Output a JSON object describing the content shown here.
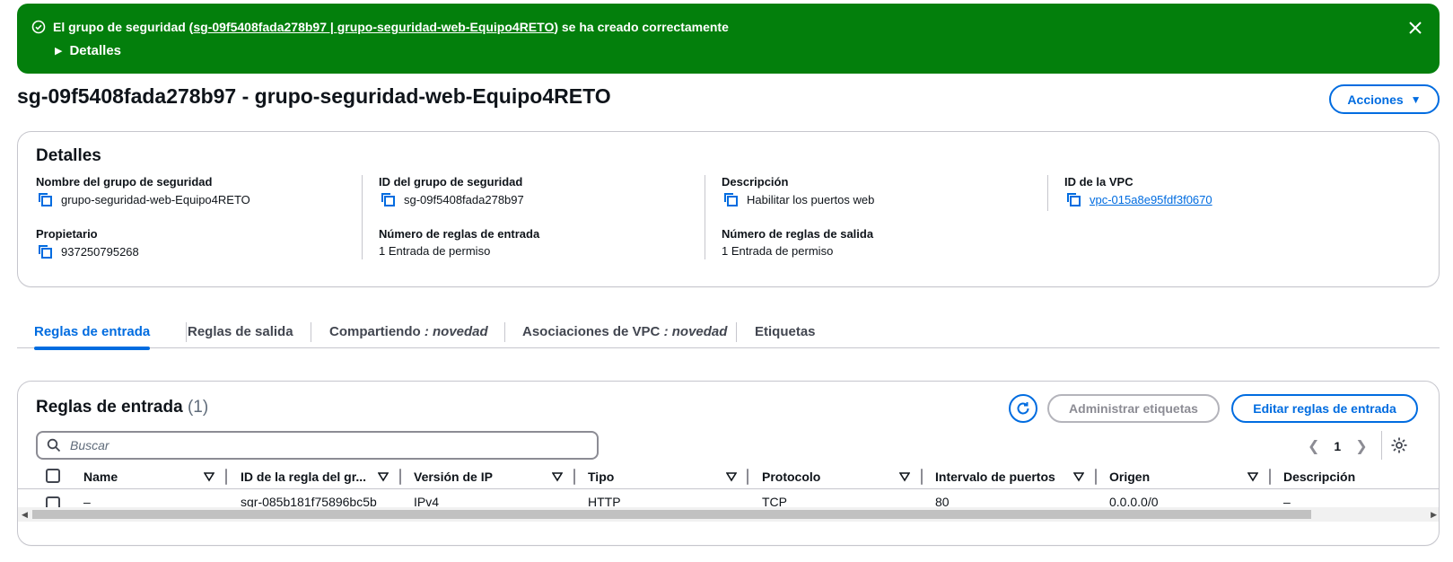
{
  "flash": {
    "text_prefix": "El grupo de seguridad (",
    "link_text": "sg-09f5408fada278b97 | grupo-seguridad-web-Equipo4RETO",
    "text_suffix": ") se ha creado correctamente",
    "details_label": "Detalles",
    "color": "#037f0c"
  },
  "page": {
    "title": "sg-09f5408fada278b97 - grupo-seguridad-web-Equipo4RETO",
    "actions_label": "Acciones"
  },
  "details": {
    "heading": "Detalles",
    "fields": [
      {
        "label": "Nombre del grupo de seguridad",
        "value": "grupo-seguridad-web-Equipo4RETO"
      },
      {
        "label": "ID del grupo de seguridad",
        "value": "sg-09f5408fada278b97"
      },
      {
        "label": "Descripción",
        "value": "Habilitar los puertos web"
      },
      {
        "label": "ID de la VPC",
        "value": "vpc-015a8e95fdf3f0670"
      },
      {
        "label": "Propietario",
        "value": "937250795268"
      },
      {
        "label": "Número de reglas de entrada",
        "value": "1 Entrada de permiso"
      },
      {
        "label": "Número de reglas de salida",
        "value": "1 Entrada de permiso"
      }
    ]
  },
  "tabs": [
    {
      "label": "Reglas de entrada",
      "suffix": ""
    },
    {
      "label": "Reglas de salida",
      "suffix": ""
    },
    {
      "label": "Compartiendo",
      "suffix": ": novedad"
    },
    {
      "label": "Asociaciones de VPC",
      "suffix": ": novedad"
    },
    {
      "label": "Etiquetas",
      "suffix": ""
    }
  ],
  "rules": {
    "heading": "Reglas de entrada",
    "count": "(1)",
    "manage_tags_label": "Administrar etiquetas",
    "edit_label": "Editar reglas de entrada",
    "search_placeholder": "Buscar",
    "page_number": "1",
    "columns": [
      "Name",
      "ID de la regla del gr...",
      "Versión de IP",
      "Tipo",
      "Protocolo",
      "Intervalo de puertos",
      "Origen",
      "Descripción"
    ],
    "rows": [
      [
        "–",
        "sgr-085b181f75896bc5b",
        "IPv4",
        "HTTP",
        "TCP",
        "80",
        "0.0.0.0/0",
        "–"
      ]
    ]
  },
  "colors": {
    "accent": "#006ce0",
    "success": "#037f0c"
  }
}
